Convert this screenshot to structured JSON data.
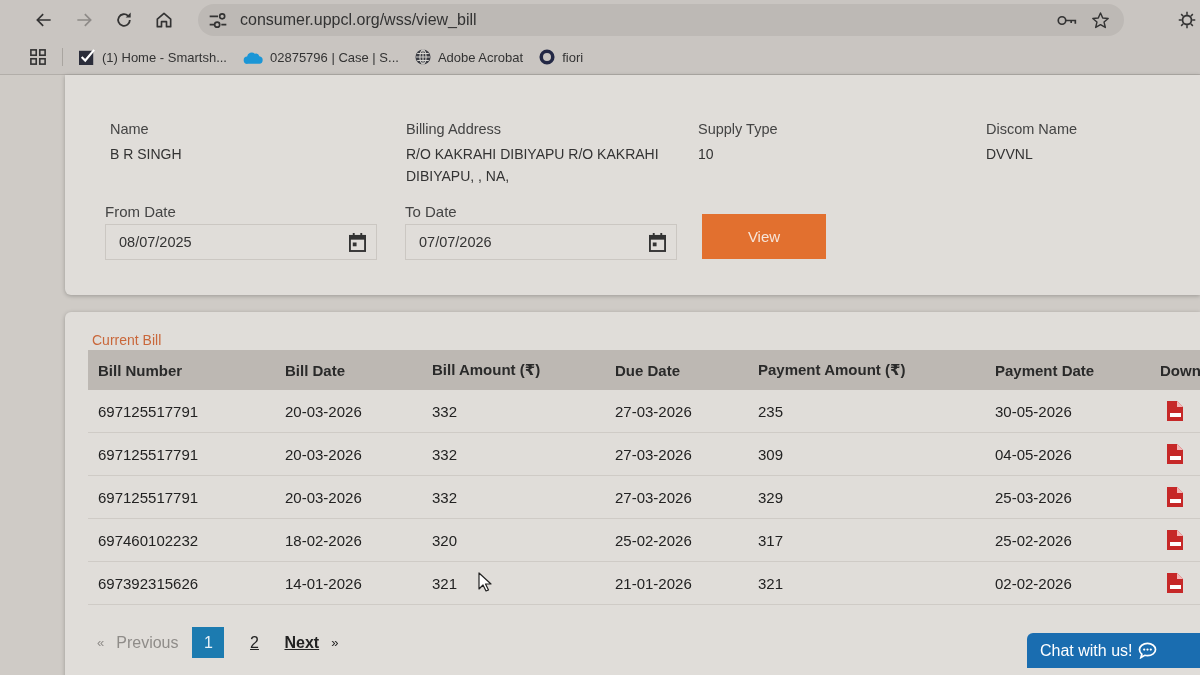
{
  "browser": {
    "forward_disabled": true,
    "url": "consumer.uppcl.org/wss/view_bill",
    "bookmarks": [
      {
        "label": "(1) Home - Smartsh...",
        "kind": "check"
      },
      {
        "label": "02875796 | Case | S...",
        "kind": "cloud"
      },
      {
        "label": "Adobe Acrobat",
        "kind": "globe"
      },
      {
        "label": "fiori",
        "kind": "ring"
      }
    ]
  },
  "consumer": [
    {
      "label": "Name",
      "value": "B R SINGH"
    },
    {
      "label": "Billing Address",
      "value": "R/O KAKRAHI DIBIYAPU R/O KAKRAHI DIBIYAPU, , NA,"
    },
    {
      "label": "Supply Type",
      "value": "10"
    },
    {
      "label": "Discom Name",
      "value": "DVVNL"
    }
  ],
  "date_filter": {
    "from": {
      "label": "From Date",
      "value": "08/07/2025"
    },
    "to": {
      "label": "To Date",
      "value": "07/07/2026"
    },
    "button": "View"
  },
  "current_bill": {
    "title": "Current Bill",
    "columns": [
      "Bill Number",
      "Bill Date",
      "Bill Amount (₹)",
      "Due Date",
      "Payment Amount (₹)",
      "Payment Date",
      "Down"
    ],
    "rows": [
      [
        "697125517791",
        "20-03-2026",
        "332",
        "27-03-2026",
        "235",
        "30-05-2026"
      ],
      [
        "697125517791",
        "20-03-2026",
        "332",
        "27-03-2026",
        "309",
        "04-05-2026"
      ],
      [
        "697125517791",
        "20-03-2026",
        "332",
        "27-03-2026",
        "329",
        "25-03-2026"
      ],
      [
        "697460102232",
        "18-02-2026",
        "320",
        "25-02-2026",
        "317",
        "25-02-2026"
      ],
      [
        "697392315626",
        "14-01-2026",
        "321",
        "21-01-2026",
        "321",
        "02-02-2026"
      ]
    ]
  },
  "pagination": {
    "previous": {
      "icon": "«",
      "label": "Previous",
      "disabled": true
    },
    "pages": [
      {
        "label": "1",
        "selected": true
      },
      {
        "label": "2",
        "selected": false
      }
    ],
    "next": {
      "label": "Next",
      "icon": "»",
      "disabled": false
    }
  },
  "chat": {
    "label": "Chat with us!"
  }
}
